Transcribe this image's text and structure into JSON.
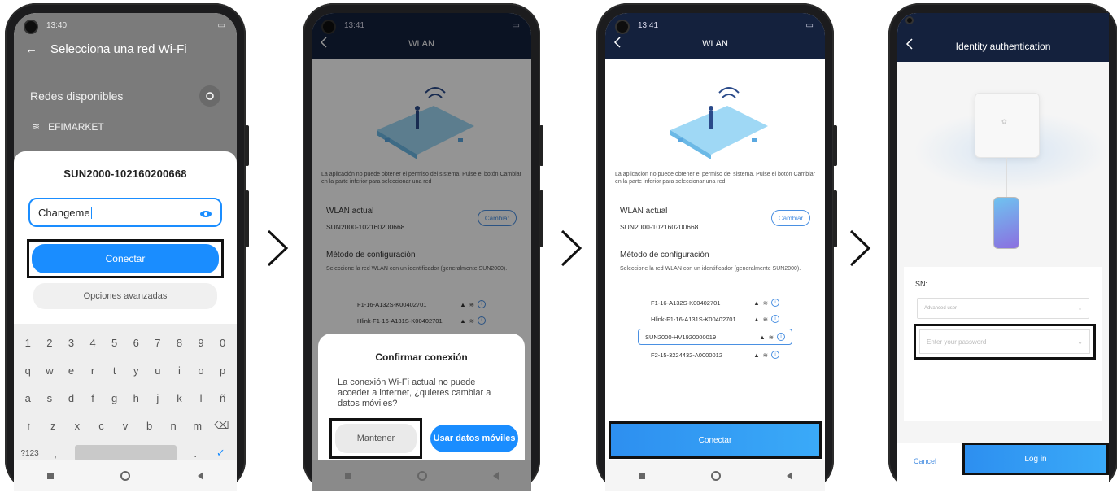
{
  "phone1": {
    "status_time": "13:40",
    "header_title": "Selecciona una red Wi-Fi",
    "available_networks_label": "Redes disponibles",
    "network_name": "EFIMARKET",
    "dialog_ssid": "SUN2000-102160200668",
    "password_value": "Changeme",
    "connect_label": "Conectar",
    "advanced_label": "Opciones avanzadas",
    "keyboard": {
      "row_numbers": [
        "1",
        "2",
        "3",
        "4",
        "5",
        "6",
        "7",
        "8",
        "9",
        "0"
      ],
      "row_1": [
        "q",
        "w",
        "e",
        "r",
        "t",
        "y",
        "u",
        "i",
        "o",
        "p"
      ],
      "row_2": [
        "a",
        "s",
        "d",
        "f",
        "g",
        "h",
        "j",
        "k",
        "l",
        "ñ"
      ],
      "row_3": [
        "↑",
        "z",
        "x",
        "c",
        "v",
        "b",
        "n",
        "m",
        "⌫"
      ],
      "row_4_left": "?123",
      "row_4_comma": ",",
      "row_4_period": ".",
      "row_4_enter": "✓"
    }
  },
  "phone2": {
    "status_time": "13:41",
    "header_title": "WLAN",
    "note": "La aplicación no puede obtener el permiso del sistema. Pulse el botón Cambiar en la parte inferior para seleccionar una red",
    "current_wlan_label": "WLAN actual",
    "current_wlan_value": "SUN2000-102160200668",
    "change_label": "Cambiar",
    "method_label": "Método de configuración",
    "method_note": "Seleccione la red WLAN con un identificador (generalmente SUN2000).",
    "networks": [
      "F1-16-A132S-K00402701",
      "Hlink-F1-16-A131S-K00402701"
    ],
    "confirm_title": "Confirmar conexión",
    "confirm_message": "La conexión Wi-Fi actual no puede acceder a internet, ¿quieres cambiar a datos móviles?",
    "keep_label": "Mantener",
    "use_data_label": "Usar datos móviles"
  },
  "phone3": {
    "status_time": "13:41",
    "header_title": "WLAN",
    "note": "La aplicación no puede obtener el permiso del sistema. Pulse el botón Cambiar en la parte inferior para seleccionar una red",
    "current_wlan_label": "WLAN actual",
    "current_wlan_value": "SUN2000-102160200668",
    "change_label": "Cambiar",
    "method_label": "Método de configuración",
    "method_note": "Seleccione la red WLAN con un identificador (generalmente SUN2000).",
    "networks": [
      "F1-16-A132S-K00402701",
      "Hlink-F1-16-A131S-K00402701",
      "SUN2000-HV1920000019",
      "F2-15-3224432-A0000012"
    ],
    "connect_label": "Conectar"
  },
  "phone4": {
    "header_title": "Identity authentication",
    "sn_label": "SN:",
    "user_select": "Advanced user",
    "password_placeholder": "Enter your password",
    "cancel_label": "Cancel",
    "login_label": "Log in"
  },
  "colors": {
    "accent": "#1a8dff",
    "header_dark": "#14213d",
    "highlight_border": "#111111"
  }
}
